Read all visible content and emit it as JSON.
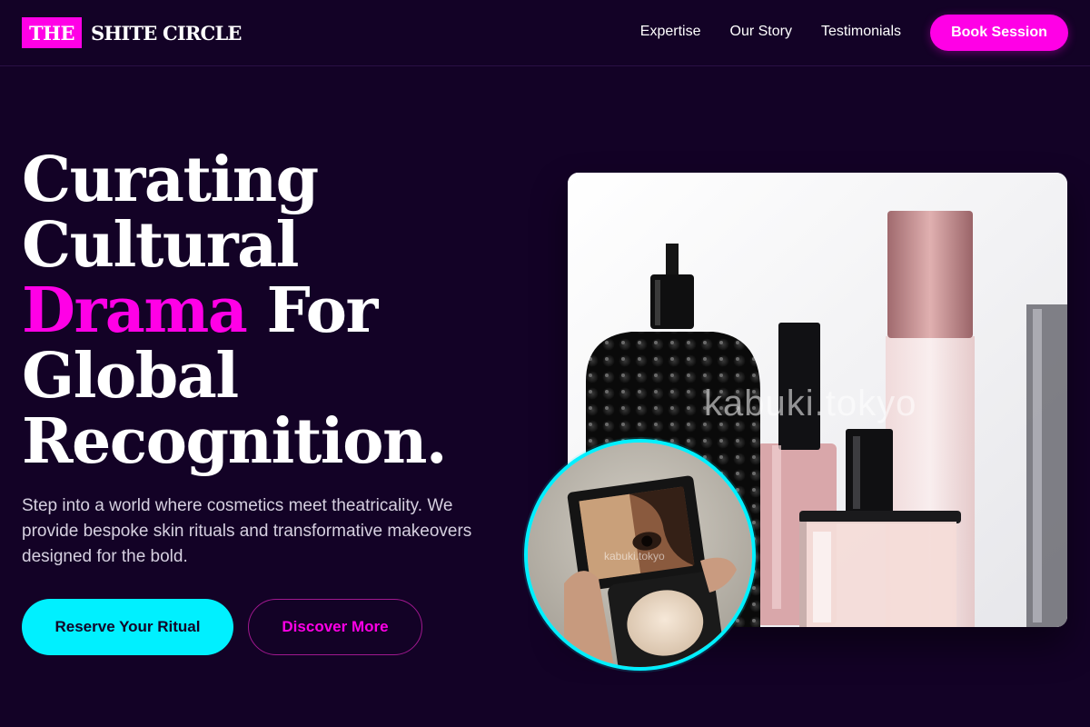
{
  "brand": {
    "logo_box": "THE",
    "logo_text": "SHITE CIRCLE",
    "accent_color": "#ff00e6",
    "secondary_color": "#00f0ff",
    "background_color": "#130226"
  },
  "nav": {
    "links": [
      "Expertise",
      "Our Story",
      "Testimonials"
    ],
    "cta_label": "Book Session"
  },
  "hero": {
    "headline_line1": "Curating",
    "headline_line2": "Cultural",
    "headline_accent": "Drama",
    "headline_line3_rest": " For",
    "headline_line4": "Global",
    "headline_line5": "Recognition.",
    "subtext": "Step into a world where cosmetics meet theatricality. We provide bespoke skin rituals and transformative makeovers designed for the bold.",
    "primary_button": "Reserve Your Ritual",
    "secondary_button": "Discover More"
  },
  "images": {
    "main_watermark": "kabuki.tokyo",
    "circle_watermark": "kabuki.tokyo"
  }
}
